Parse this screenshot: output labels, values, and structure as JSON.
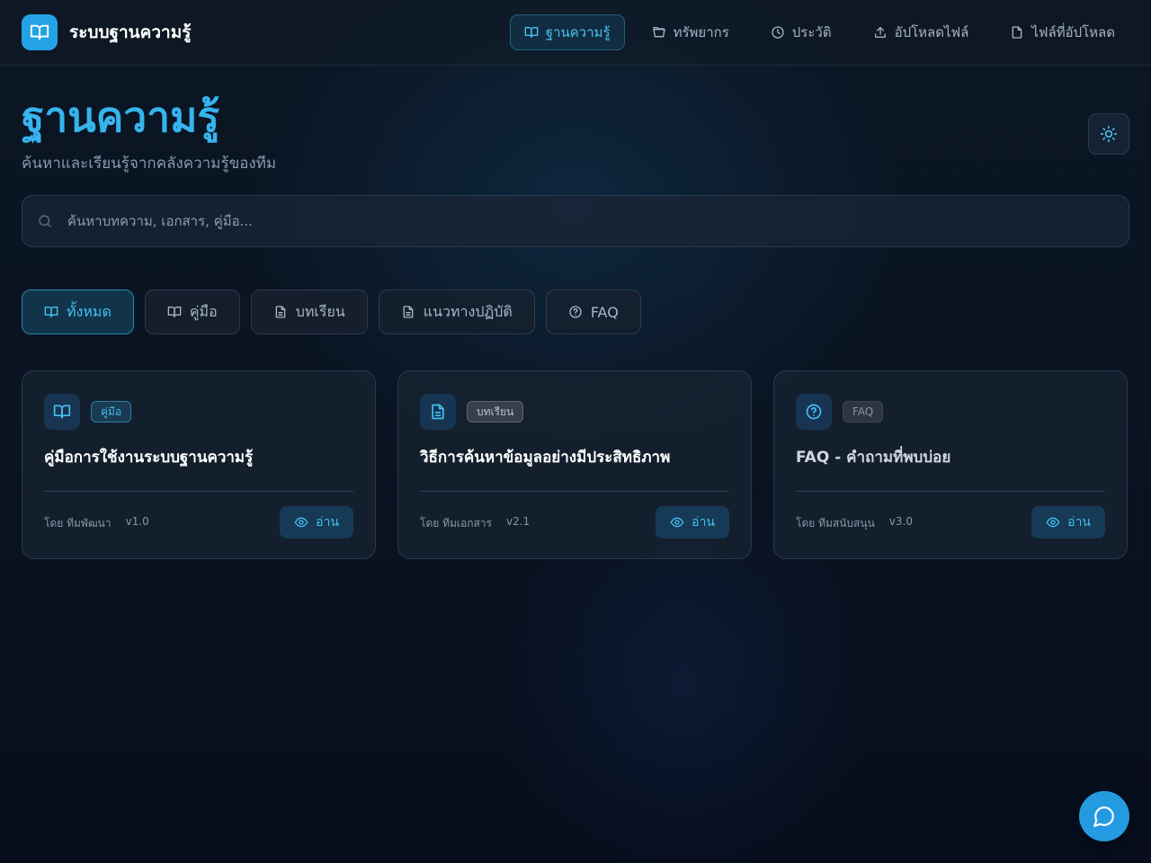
{
  "brand": {
    "title": "ระบบฐานความรู้",
    "icon": "book-open-icon"
  },
  "nav": {
    "items": [
      {
        "label": "ฐานความรู้",
        "icon": "book-open-icon",
        "active": true
      },
      {
        "label": "ทรัพยากร",
        "icon": "folder-open-icon",
        "active": false
      },
      {
        "label": "ประวัติ",
        "icon": "clock-icon",
        "active": false
      },
      {
        "label": "อัปโหลดไฟล์",
        "icon": "upload-icon",
        "active": false
      },
      {
        "label": "ไฟล์ที่อัปโหลด",
        "icon": "file-icon",
        "active": false
      }
    ]
  },
  "header": {
    "title": "ฐานความรู้",
    "subtitle": "ค้นหาและเรียนรู้จากคลังความรู้ของทีม",
    "theme_toggle_icon": "sun-icon"
  },
  "search": {
    "placeholder": "ค้นหาบทความ, เอกสาร, คู่มือ..."
  },
  "filters": [
    {
      "label": "ทั้งหมด",
      "icon": "book-open-icon",
      "active": true
    },
    {
      "label": "คู่มือ",
      "icon": "book-open-icon",
      "active": false
    },
    {
      "label": "บทเรียน",
      "icon": "file-text-icon",
      "active": false
    },
    {
      "label": "แนวทางปฏิบัติ",
      "icon": "file-text-icon",
      "active": false
    },
    {
      "label": "FAQ",
      "icon": "help-circle-icon",
      "active": false
    }
  ],
  "cards": [
    {
      "category": "คู่มือ",
      "icon": "book-open-icon",
      "title": "คู่มือการใช้งานระบบฐานความรู้",
      "author": "โดย ทีมพัฒนา",
      "version": "v1.0",
      "action": "อ่าน"
    },
    {
      "category": "บทเรียน",
      "icon": "file-text-icon",
      "title": "วิธีการค้นหาข้อมูลอย่างมีประสิทธิภาพ",
      "author": "โดย ทีมเอกสาร",
      "version": "v2.1",
      "action": "อ่าน"
    },
    {
      "category": "FAQ",
      "icon": "help-circle-icon",
      "title": "FAQ - คำถามที่พบบ่อย",
      "author": "โดย ทีมสนับสนุน",
      "version": "v3.0",
      "action": "อ่าน"
    }
  ],
  "chat": {
    "icon": "chat-bubble-icon"
  },
  "colors": {
    "accent": "#36b4ee",
    "brand": "#23a3e6",
    "background": "#0a1422"
  }
}
